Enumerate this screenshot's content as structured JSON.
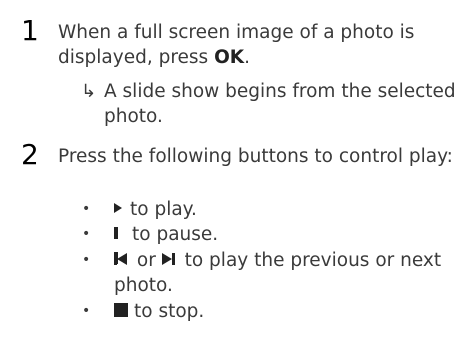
{
  "steps": [
    {
      "number": "1",
      "text_before": "When a full screen image of a photo is displayed, press ",
      "bold": "OK",
      "text_after": ".",
      "result": {
        "arrow": "↳",
        "text": "A slide show begins from the selected photo."
      }
    },
    {
      "number": "2",
      "text": "Press the following buttons to control play:",
      "bullets": [
        {
          "icon": "play-icon",
          "text": "to play."
        },
        {
          "icon": "pause-icon",
          "text": "to pause."
        },
        {
          "icon_a": "previous-icon",
          "joiner": "or",
          "icon_b": "next-icon",
          "text": "to play the previous or next photo."
        },
        {
          "icon": "stop-icon",
          "text": "to stop."
        }
      ]
    }
  ],
  "bullet_char": "•",
  "colors": {
    "text": "#3a3a3a",
    "heading": "#000000",
    "icon": "#222222"
  }
}
